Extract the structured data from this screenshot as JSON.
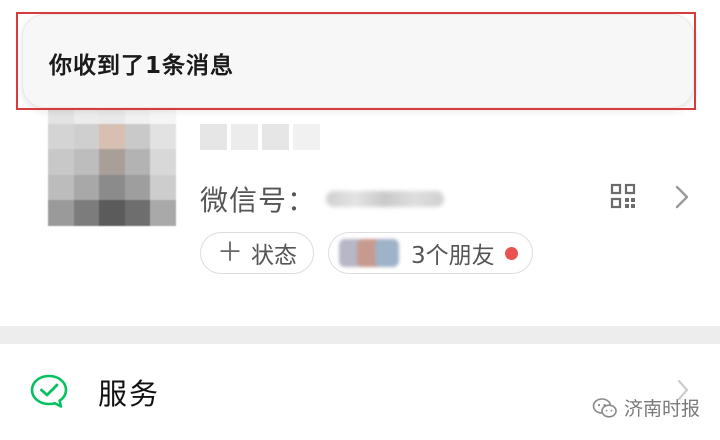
{
  "notification": {
    "text": "你收到了1条消息"
  },
  "profile": {
    "wechat_id_label": "微信号：",
    "status_button": {
      "icon": "plus-icon",
      "plus": "＋",
      "label": "状态"
    },
    "friends_button": {
      "label": "3个朋友"
    }
  },
  "menu": {
    "service": {
      "label": "服务",
      "icon": "service-icon"
    }
  },
  "watermark": {
    "text": "济南时报"
  },
  "colors": {
    "accent_green": "#07c160",
    "badge_red": "#e9534f",
    "outline_red": "#d73b3b"
  }
}
